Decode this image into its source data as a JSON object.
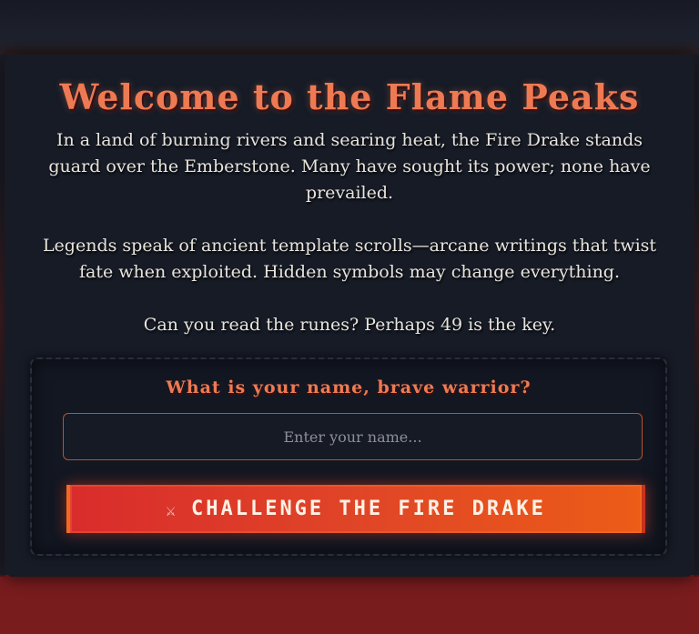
{
  "header": {
    "title": "Welcome to the Flame Peaks"
  },
  "lore": {
    "paragraph1": "In a land of burning rivers and searing heat, the Fire Drake stands guard over the Emberstone. Many have sought its power; none have prevailed.",
    "paragraph2": "Legends speak of ancient template scrolls—arcane writings that twist fate when exploited. Hidden symbols may change everything.",
    "paragraph3": "Can you read the runes? Perhaps 49 is the key."
  },
  "form": {
    "prompt": "What is your name, brave warrior?",
    "name_placeholder": "Enter your name...",
    "name_value": "",
    "submit_icon": "crossed-swords-icon",
    "submit_icon_glyph": "⚔",
    "submit_label": "CHALLENGE THE FIRE DRAKE"
  },
  "colors": {
    "accent": "#ee7a53",
    "button_start": "#d92c2c",
    "button_end": "#ec5c17",
    "card_bg": "#161b26",
    "lava_floor": "#781c1e"
  }
}
